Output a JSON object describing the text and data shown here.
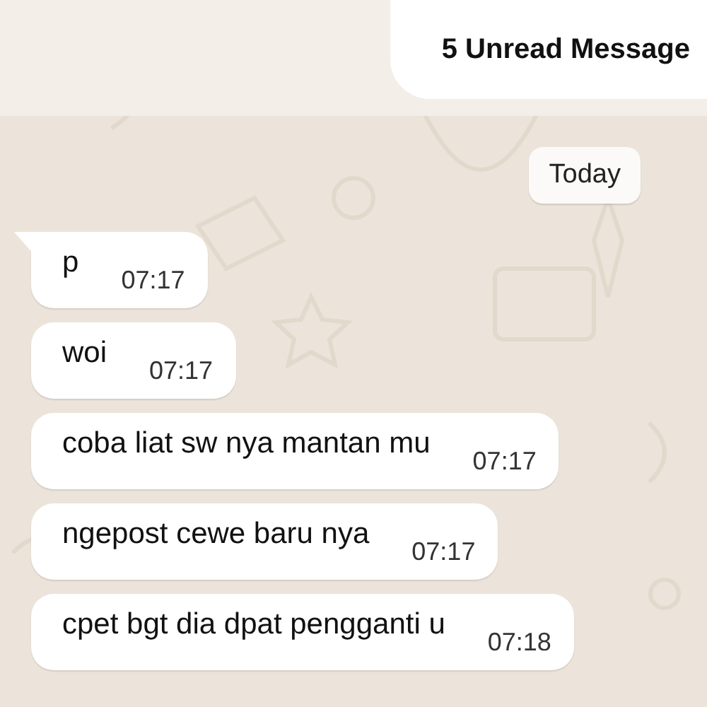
{
  "banner": {
    "text": "5 Unread Message"
  },
  "date_chip": "Today",
  "messages": [
    {
      "text": "p",
      "time": "07:17",
      "tail": true
    },
    {
      "text": "woi",
      "time": "07:17",
      "tail": false
    },
    {
      "text": "coba liat sw nya mantan mu",
      "time": "07:17",
      "tail": false
    },
    {
      "text": "ngepost cewe baru nya",
      "time": "07:17",
      "tail": false
    },
    {
      "text": "cpet bgt dia dpat pengganti u",
      "time": "07:18",
      "tail": false
    }
  ]
}
